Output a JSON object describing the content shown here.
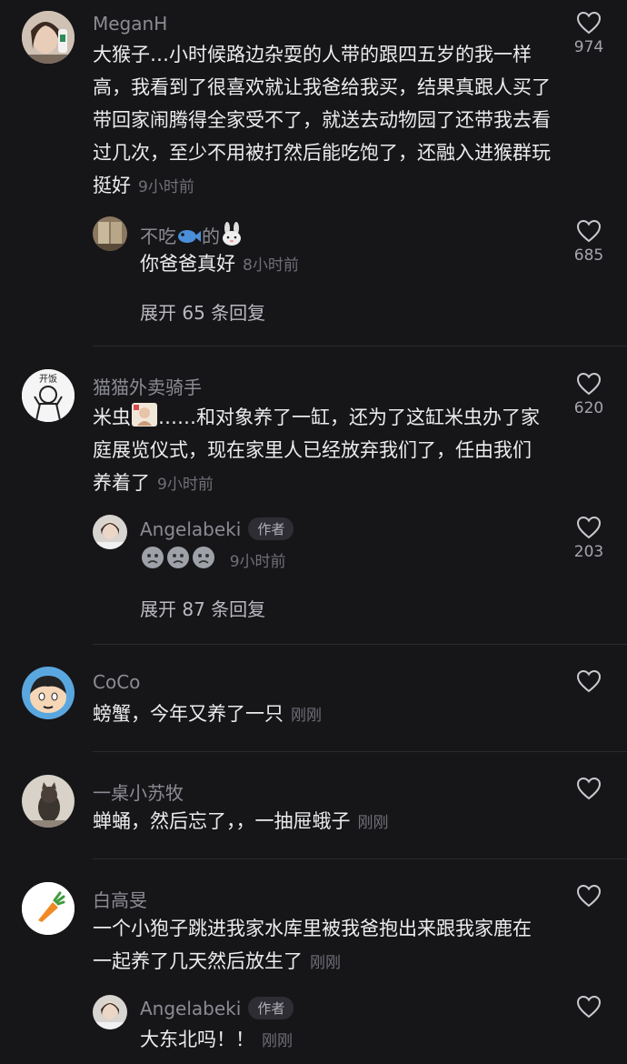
{
  "comments": [
    {
      "username": "MeganH",
      "text": "大猴子…小时候路边杂耍的人带的跟四五岁的我一样高，我看到了很喜欢就让我爸给我买，结果真跟人买了带回家闹腾得全家受不了，就送去动物园了还带我去看过几次，至少不用被打然后能吃饱了，还融入进猴群玩挺好",
      "time": "9小时前",
      "likes": "974",
      "replies": [
        {
          "username_a": "不吃",
          "username_b": "的",
          "text": "你爸爸真好",
          "time": "8小时前",
          "likes": "685"
        }
      ],
      "expand": "展开 65 条回复"
    },
    {
      "username": "猫猫外卖骑手",
      "text_a": "米虫",
      "text_b": "……和对象养了一缸，还为了这缸米虫办了家庭展览仪式，现在家里人已经放弃我们了，任由我们养着了",
      "time": "9小时前",
      "likes": "620",
      "avatar_text": "开饭",
      "replies": [
        {
          "username": "Angelabeki",
          "badge": "作者",
          "time": "9小时前",
          "likes": "203"
        }
      ],
      "expand": "展开 87 条回复"
    },
    {
      "username": "CoCo",
      "text": "螃蟹，今年又养了一只",
      "time": "刚刚"
    },
    {
      "username": "一桌小苏牧",
      "text": "蝉蛹，然后忘了，，一抽屉蛾子",
      "time": "刚刚"
    },
    {
      "username": "白高旻",
      "text": "一个小狍子跳进我家水库里被我爸抱出来跟我家鹿在一起养了几天然后放生了",
      "time": "刚刚",
      "replies": [
        {
          "username": "Angelabeki",
          "badge": "作者",
          "text": "大东北吗！！",
          "time": "刚刚"
        }
      ]
    }
  ],
  "colors": {
    "background": "#161619",
    "username": "#8b8b93",
    "text": "#ececef",
    "time": "#6f6f77"
  }
}
